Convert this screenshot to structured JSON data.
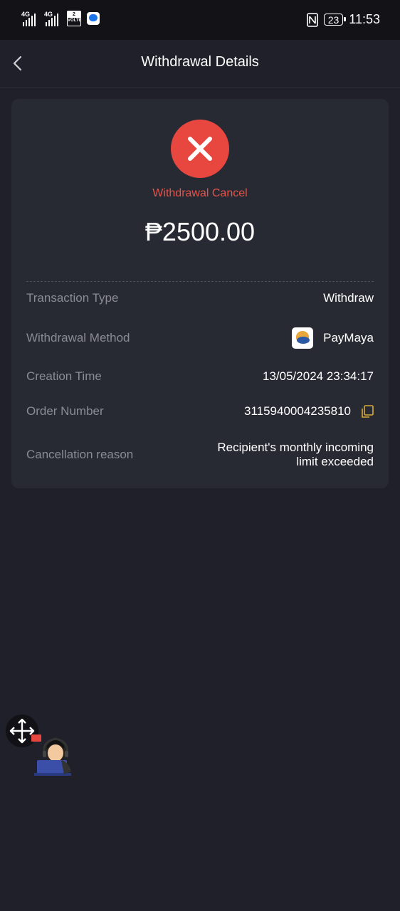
{
  "status_bar": {
    "signal1": "4G",
    "signal2": "4G",
    "volte_num": "2",
    "volte_label": "VOLTE",
    "battery": "23",
    "time": "11:53"
  },
  "header": {
    "title": "Withdrawal Details"
  },
  "status": {
    "label": "Withdrawal Cancel",
    "amount": "₱2500.00",
    "color": "#e8473f"
  },
  "details": {
    "transaction_type": {
      "label": "Transaction Type",
      "value": "Withdraw"
    },
    "method": {
      "label": "Withdrawal Method",
      "value": "PayMaya",
      "icon": "paymaya-logo-icon"
    },
    "creation_time": {
      "label": "Creation Time",
      "value": "13/05/2024 23:34:17"
    },
    "order_number": {
      "label": "Order Number",
      "value": "3115940004235810",
      "icon": "copy-icon"
    },
    "cancellation_reason": {
      "label": "Cancellation reason",
      "line1": "Recipient's monthly incoming",
      "line2": "limit exceeded"
    }
  },
  "colors": {
    "background": "#1f2029",
    "card": "#282a33",
    "accent_copy": "#d9a93b"
  }
}
